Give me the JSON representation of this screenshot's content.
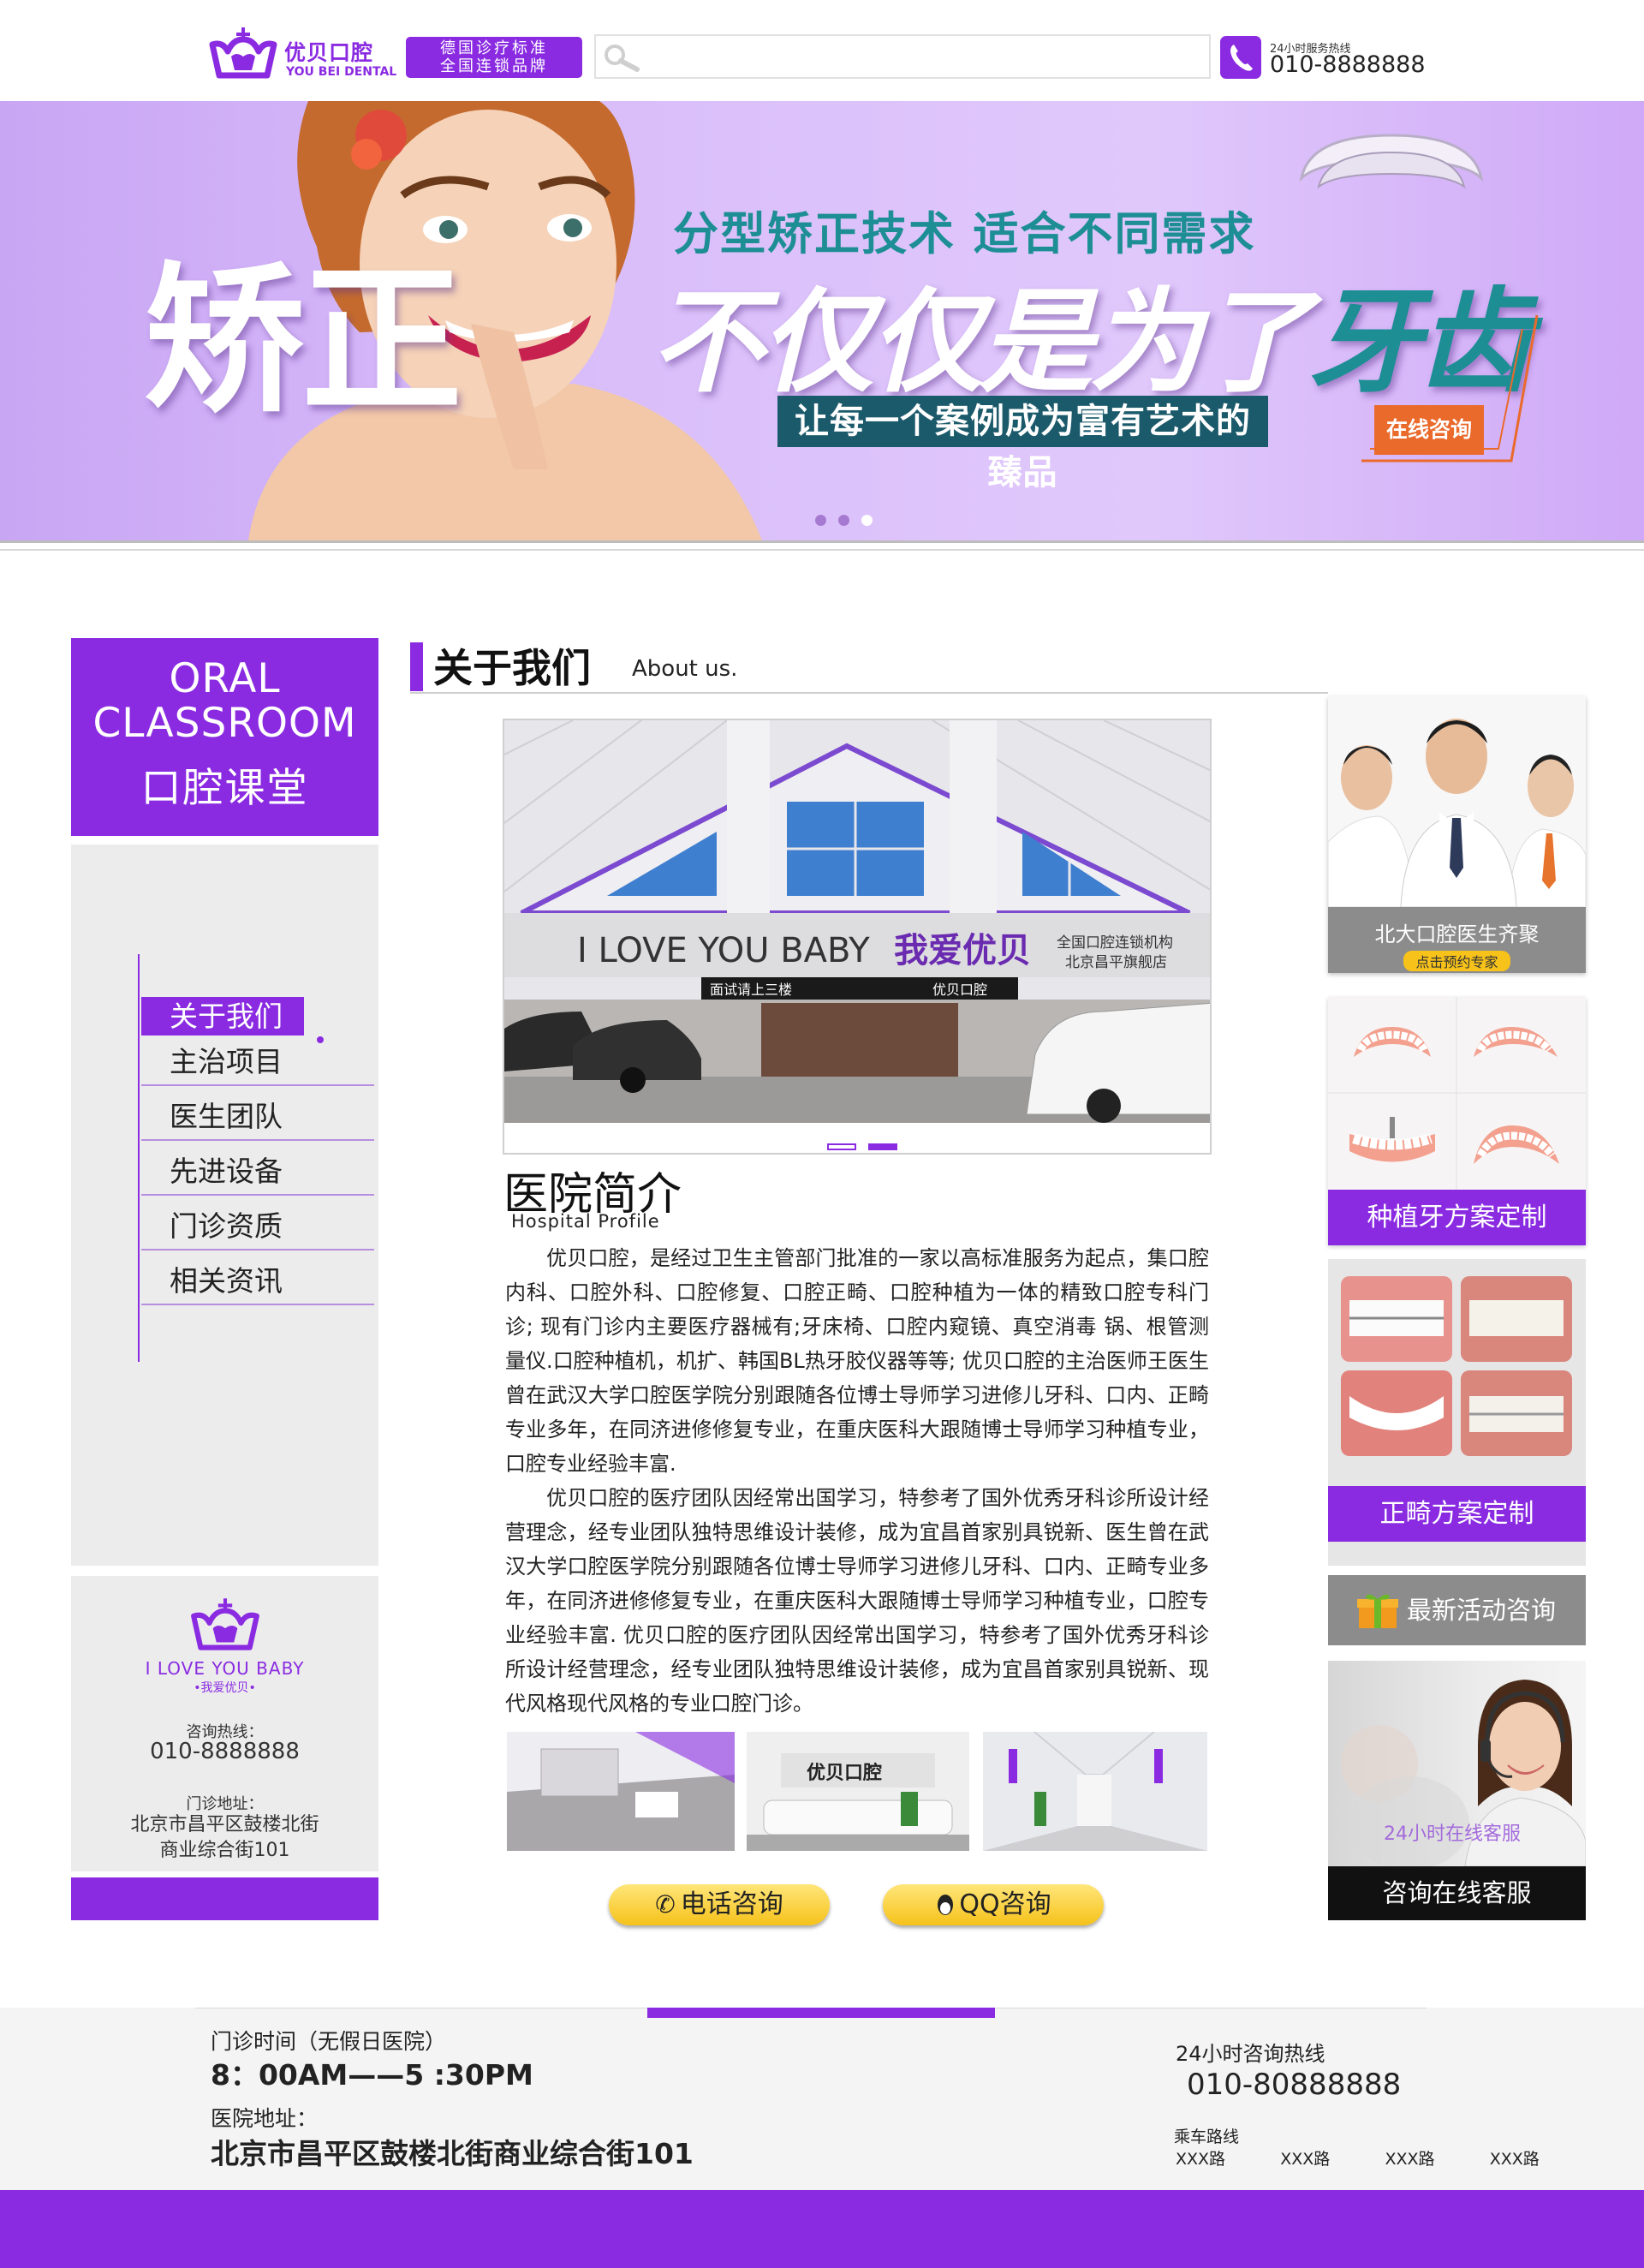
{
  "header": {
    "logo_cn": "优贝口腔",
    "logo_en": "YOU BEI DENTAL",
    "slogan_line1": "德国诊疗标准",
    "slogan_line2": "全国连锁品牌",
    "search_placeholder": "",
    "hotline_label": "24小时服务热线",
    "hotline_number": "010-8888888"
  },
  "banner": {
    "headline_left": "矫正",
    "subtitle": "分型矫正技术  适合不同需求",
    "headline_right_white": "不仅仅是为了",
    "headline_right_teal": "牙齿",
    "tagline": "让每一个案例成为富有艺术的臻品",
    "cta": "在线咨询",
    "slide_count": 3,
    "active_slide": 3
  },
  "sidebar": {
    "title_en_line1": "ORAL",
    "title_en_line2": "CLASSROOM",
    "title_cn": "口腔课堂",
    "nav": [
      {
        "label": "关于我们",
        "active": true
      },
      {
        "label": "主治项目",
        "active": false
      },
      {
        "label": "医生团队",
        "active": false
      },
      {
        "label": "先进设备",
        "active": false
      },
      {
        "label": "门诊资质",
        "active": false
      },
      {
        "label": "相关资讯",
        "active": false
      }
    ],
    "contact": {
      "brand_en": "I LOVE YOU BABY",
      "brand_cn": "•我爱优贝•",
      "hotline_label": "咨询热线：",
      "hotline": "010-8888888",
      "address_label": "门诊地址：",
      "address_line1": "北京市昌平区鼓楼北街",
      "address_line2": "商业综合街101"
    }
  },
  "about": {
    "title": "关于我们",
    "title_en": "About us.",
    "storefront_sign_en": "I LOVE YOU BABY",
    "storefront_sign_cn": "我爱优贝",
    "storefront_sub1": "全国口腔连锁机构",
    "storefront_sub2": "北京昌平旗舰店",
    "storefront_door_left": "面试请上三楼",
    "storefront_door_right": "优贝口腔",
    "photo_slide_count": 2,
    "photo_active_slide": 2,
    "profile_title": "医院简介",
    "profile_title_en": "Hospital Profile",
    "profile_para1": "优贝口腔，是经过卫生主管部门批准的一家以高标准服务为起点，集口腔内科、口腔外科、口腔修复、口腔正畸、口腔种植为一体的精致口腔专科门诊;         现有门诊内主要医疗器械有;牙床椅、口腔内窥镜、真空消毒 锅、根管测量仪.口腔种植机，机扩、韩国BL热牙胶仪器等等;     优贝口腔的主治医师王医生曾在武汉大学口腔医学院分别跟随各位博士导师学习进修儿牙科、口内、正畸专业多年，在同济进修修复专业，在重庆医科大跟随博士导师学习种植专业，口腔专业经验丰富.",
    "profile_para2": "优贝口腔的医疗团队因经常出国学习，特参考了国外优秀牙科诊所设计经营理念，经专业团队独特思维设计装修，成为宜昌首家别具锐新、医生曾在武汉大学口腔医学院分别跟随各位博士导师学习进修儿牙科、口内、正畸专业多年，在同济进修修复专业，在重庆医科大跟随博士导师学习种植专业，口腔专业经验丰富.      优贝口腔的医疗团队因经常出国学习，特参考了国外优秀牙科诊所设计经营理念，经专业团队独特思维设计装修，成为宜昌首家别具锐新、现代风格现代风格的专业口腔门诊。",
    "thumb2_sign": "优贝口腔",
    "phone_button": "电话咨询",
    "qq_button": "QQ咨询"
  },
  "right": {
    "doctors_caption": "北大口腔医生齐聚",
    "doctors_badge": "点击预约专家",
    "implant_caption": "种植牙方案定制",
    "ortho_caption": "正畸方案定制",
    "events_label": "最新活动咨询",
    "service_overlay": "24小时在线客服",
    "service_caption": "咨询在线客服"
  },
  "footer": {
    "hours_label": "门诊时间（无假日医院）",
    "hours": "8：00AM——5 :30PM",
    "address_label": "医院地址：",
    "address": "北京市昌平区鼓楼北街商业综合街101",
    "hotline_label": "24小时咨询热线",
    "hotline": "010-80888888",
    "route_label": "乘车路线",
    "routes": [
      "XXX路",
      "XXX路",
      "XXX路",
      "XXX路"
    ]
  },
  "colors": {
    "brand_purple": "#8a2be2",
    "teal": "#1d8e94",
    "banner_tag_bg": "#1b5a6b",
    "cta_orange": "#ea6a2b",
    "gray_panel": "#ececec",
    "button_gold": "#f6c21a"
  },
  "icons": [
    "crown-logo-icon",
    "search-icon",
    "phone-icon",
    "gift-icon",
    "qq-penguin-icon",
    "handset-icon"
  ]
}
